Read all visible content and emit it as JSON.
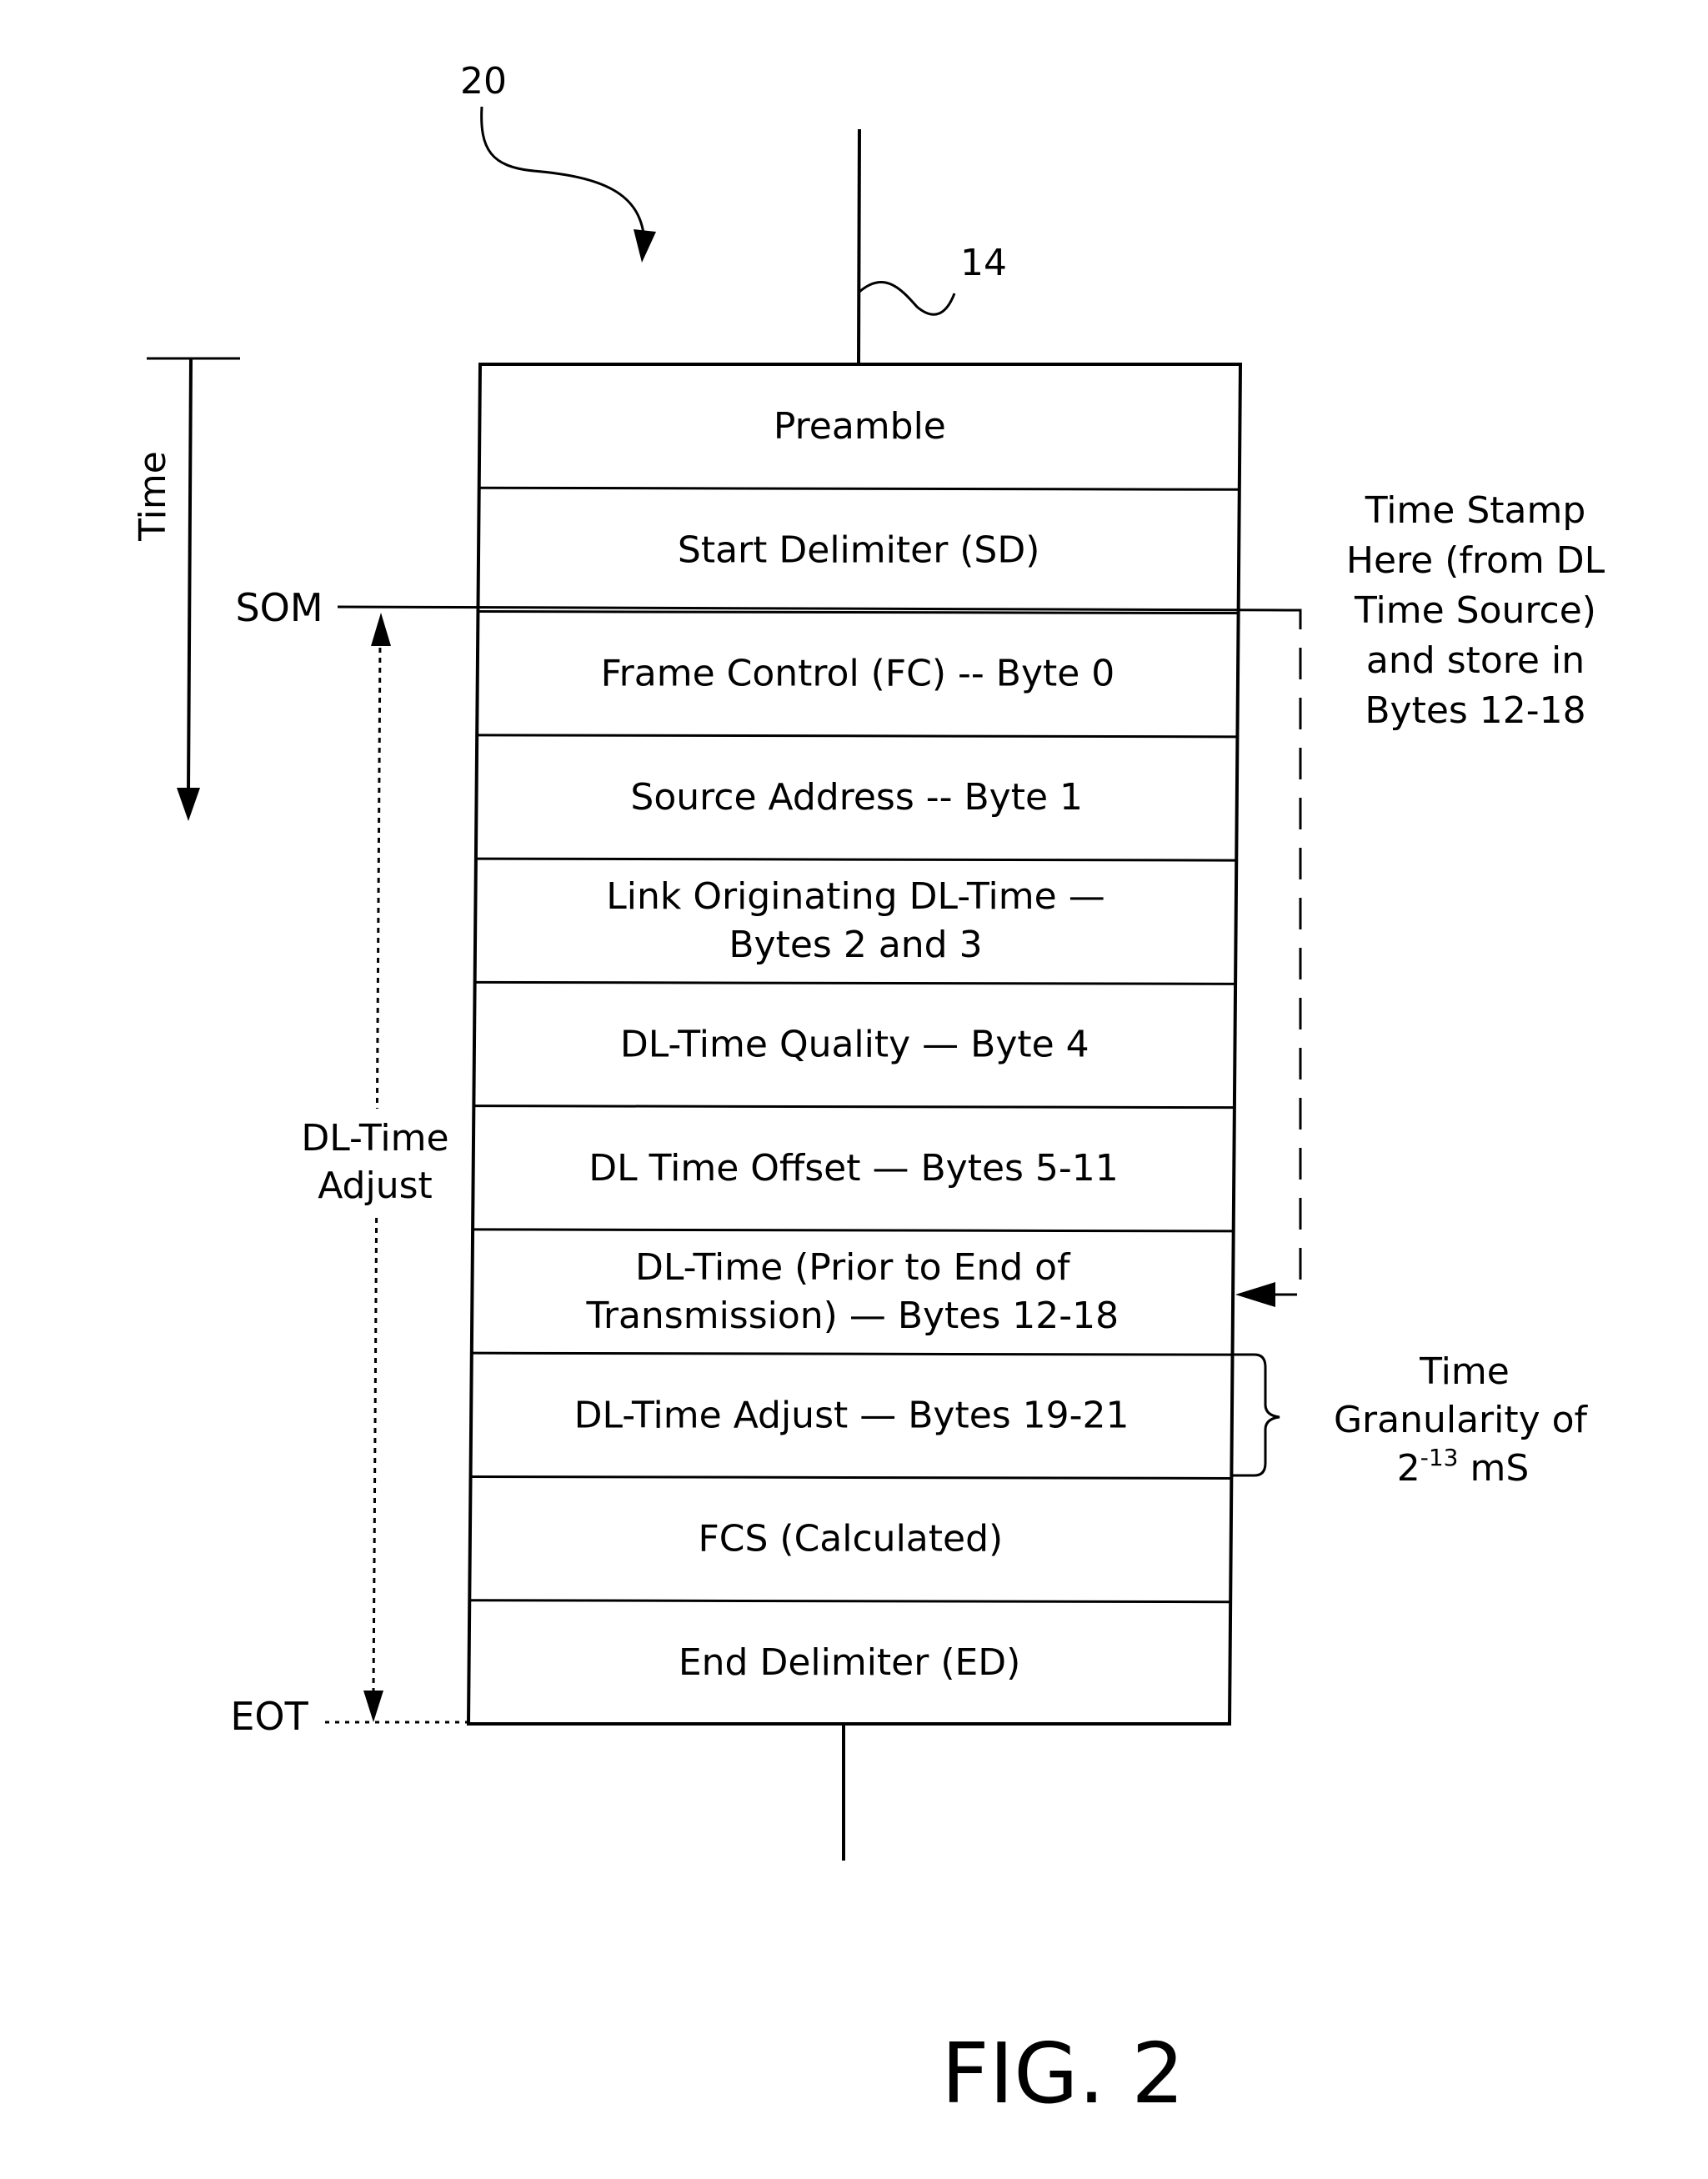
{
  "figure": {
    "label": "FIG. 2",
    "ref_frame": "20",
    "ref_line": "14"
  },
  "time_axis": {
    "label": "Time",
    "som_label": "SOM",
    "eot_label": "EOT",
    "adjust_label_line1": "DL-Time",
    "adjust_label_line2": "Adjust"
  },
  "fields": [
    {
      "lines": [
        "Preamble"
      ]
    },
    {
      "lines": [
        "Start Delimiter (SD)"
      ]
    },
    {
      "lines": [
        "Frame Control (FC) -- Byte 0"
      ]
    },
    {
      "lines": [
        "Source Address -- Byte 1"
      ]
    },
    {
      "lines": [
        "Link Originating DL-Time —",
        "Bytes 2 and 3"
      ]
    },
    {
      "lines": [
        "DL-Time Quality — Byte 4"
      ]
    },
    {
      "lines": [
        "DL Time Offset — Bytes 5-11"
      ]
    },
    {
      "lines": [
        "DL-Time (Prior to End of",
        "Transmission) — Bytes 12-18"
      ]
    },
    {
      "lines": [
        "DL-Time Adjust — Bytes 19-21"
      ]
    },
    {
      "lines": [
        "FCS (Calculated)"
      ]
    },
    {
      "lines": [
        "End Delimiter (ED)"
      ]
    }
  ],
  "annotations": {
    "timestamp_note": [
      "Time Stamp",
      "Here (from DL",
      "Time Source)",
      "and store in",
      "Bytes 12-18"
    ],
    "granularity_line1": "Time",
    "granularity_line2": "Granularity of",
    "granularity_base": "2",
    "granularity_exp": "-13",
    "granularity_unit": " mS"
  }
}
